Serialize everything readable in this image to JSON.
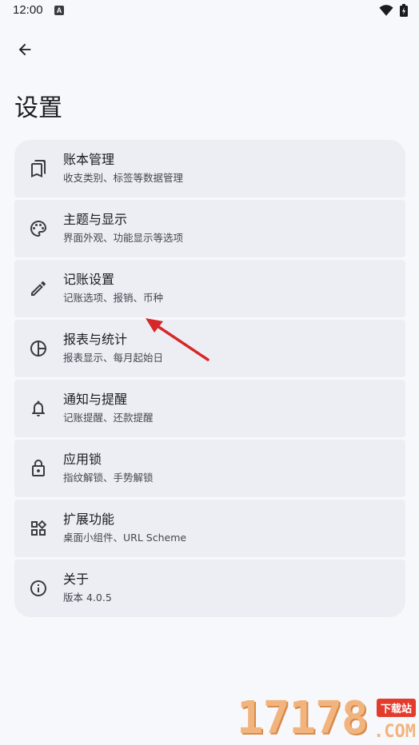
{
  "status_bar": {
    "time": "12:00",
    "notification_badge": "A"
  },
  "header": {
    "back_icon": "arrow-back-icon",
    "title": "设置"
  },
  "settings": [
    {
      "key": "ledger",
      "icon": "bookmarks-icon",
      "title": "账本管理",
      "subtitle": "收支类别、标签等数据管理"
    },
    {
      "key": "theme",
      "icon": "palette-icon",
      "title": "主题与显示",
      "subtitle": "界面外观、功能显示等选项"
    },
    {
      "key": "bookkeeping",
      "icon": "pencil-icon",
      "title": "记账设置",
      "subtitle": "记账选项、报销、币种"
    },
    {
      "key": "reports",
      "icon": "pie-chart-icon",
      "title": "报表与统计",
      "subtitle": "报表显示、每月起始日"
    },
    {
      "key": "notifications",
      "icon": "bell-icon",
      "title": "通知与提醒",
      "subtitle": "记账提醒、还款提醒"
    },
    {
      "key": "app_lock",
      "icon": "lock-icon",
      "title": "应用锁",
      "subtitle": "指纹解锁、手势解锁"
    },
    {
      "key": "extensions",
      "icon": "widgets-icon",
      "title": "扩展功能",
      "subtitle": "桌面小组件、URL Scheme"
    },
    {
      "key": "about",
      "icon": "info-icon",
      "title": "关于",
      "subtitle": "版本 4.0.5"
    }
  ],
  "watermark": {
    "digits": "17178",
    "badge": "下载站",
    "suffix": ".COM"
  },
  "colors": {
    "background": "#f7f8fc",
    "card": "#eceef4",
    "annotation_arrow": "#d62828"
  }
}
